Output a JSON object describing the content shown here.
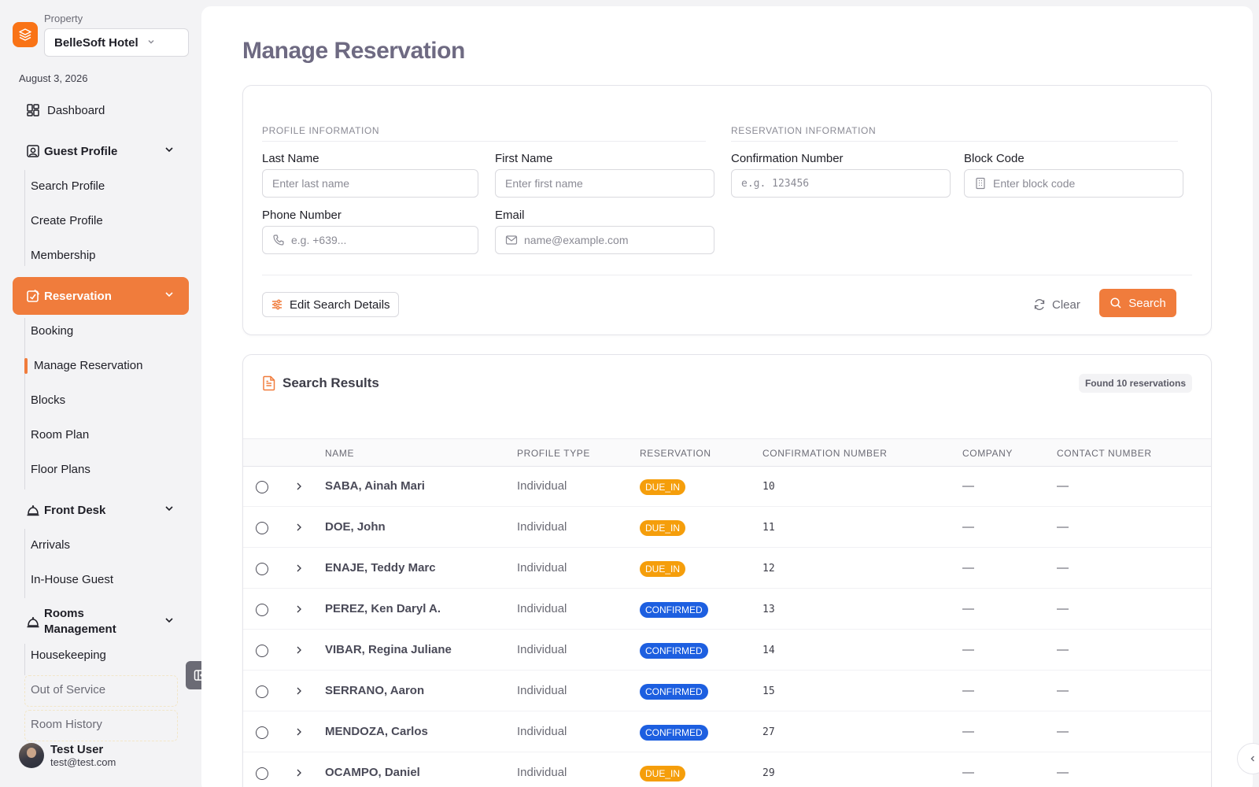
{
  "sidebar": {
    "property_label": "Property",
    "property_value": "BelleSoft Hotel",
    "date": "August 3, 2026",
    "dashboard": "Dashboard",
    "guest_profile": {
      "label": "Guest Profile",
      "items": [
        "Search Profile",
        "Create Profile",
        "Membership"
      ]
    },
    "reservation": {
      "label": "Reservation",
      "items": [
        "Booking",
        "Manage Reservation",
        "Blocks",
        "Room Plan",
        "Floor Plans"
      ]
    },
    "front_desk": {
      "label": "Front Desk",
      "items": [
        "Arrivals",
        "In-House Guest"
      ]
    },
    "rooms_management": {
      "label_line1": "Rooms",
      "label_line2": "Management",
      "items": [
        "Housekeeping",
        "Out of Service",
        "Room History"
      ]
    },
    "user": {
      "name": "Test User",
      "email": "test@test.com"
    }
  },
  "page": {
    "title": "Manage Reservation"
  },
  "search_form": {
    "profile_section": "PROFILE INFORMATION",
    "reservation_section": "RESERVATION INFORMATION",
    "last_name": {
      "label": "Last Name",
      "placeholder": "Enter last name",
      "value": ""
    },
    "first_name": {
      "label": "First Name",
      "placeholder": "Enter first name",
      "value": ""
    },
    "phone": {
      "label": "Phone Number",
      "placeholder": "e.g. +639...",
      "value": ""
    },
    "email": {
      "label": "Email",
      "placeholder": "name@example.com",
      "value": ""
    },
    "confirmation": {
      "label": "Confirmation Number",
      "placeholder": "e.g. 123456",
      "value": ""
    },
    "block_code": {
      "label": "Block Code",
      "placeholder": "Enter block code",
      "value": ""
    },
    "edit_button": "Edit Search Details",
    "clear_button": "Clear",
    "search_button": "Search"
  },
  "results": {
    "title": "Search Results",
    "found": "Found 10 reservations",
    "columns": [
      "NAME",
      "PROFILE TYPE",
      "RESERVATION",
      "CONFIRMATION NUMBER",
      "COMPANY",
      "CONTACT NUMBER"
    ],
    "rows": [
      {
        "name": "SABA, Ainah Mari",
        "profile_type": "Individual",
        "status": "DUE_IN",
        "confirmation": "10",
        "company": "—",
        "contact": "—"
      },
      {
        "name": "DOE, John",
        "profile_type": "Individual",
        "status": "DUE_IN",
        "confirmation": "11",
        "company": "—",
        "contact": "—"
      },
      {
        "name": "ENAJE, Teddy Marc",
        "profile_type": "Individual",
        "status": "DUE_IN",
        "confirmation": "12",
        "company": "—",
        "contact": "—"
      },
      {
        "name": "PEREZ, Ken Daryl A.",
        "profile_type": "Individual",
        "status": "CONFIRMED",
        "confirmation": "13",
        "company": "—",
        "contact": "—"
      },
      {
        "name": "VIBAR, Regina Juliane",
        "profile_type": "Individual",
        "status": "CONFIRMED",
        "confirmation": "14",
        "company": "—",
        "contact": "—"
      },
      {
        "name": "SERRANO, Aaron",
        "profile_type": "Individual",
        "status": "CONFIRMED",
        "confirmation": "15",
        "company": "—",
        "contact": "—"
      },
      {
        "name": "MENDOZA, Carlos",
        "profile_type": "Individual",
        "status": "CONFIRMED",
        "confirmation": "27",
        "company": "—",
        "contact": "—"
      },
      {
        "name": "OCAMPO, Daniel",
        "profile_type": "Individual",
        "status": "DUE_IN",
        "confirmation": "29",
        "company": "—",
        "contact": "—"
      }
    ]
  },
  "colors": {
    "accent": "#f07c3c",
    "due_in": "#f59e0b",
    "confirmed": "#1d5fe0"
  }
}
